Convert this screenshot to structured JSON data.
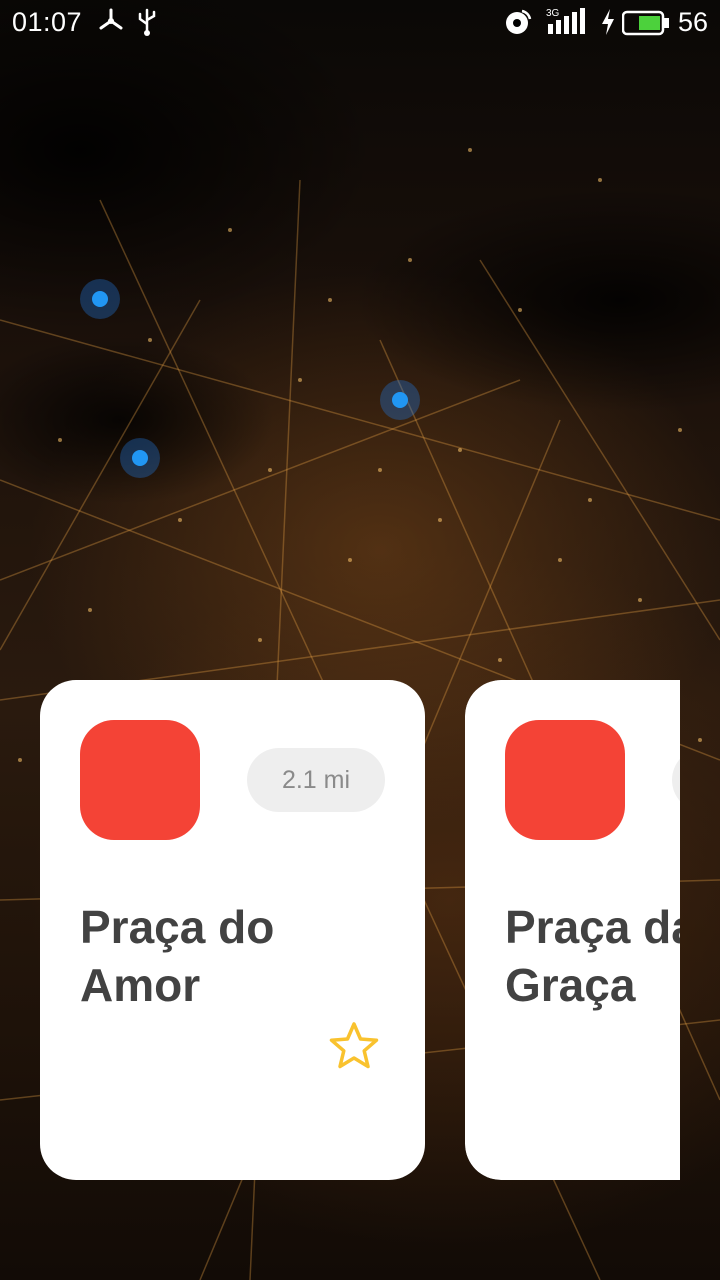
{
  "status_bar": {
    "time": "01:07",
    "battery_level": "56",
    "network": "3G",
    "icons": [
      "fan-icon",
      "usb-icon",
      "hotspot-icon",
      "signal-icon",
      "charging-icon",
      "battery-icon"
    ]
  },
  "map": {
    "markers": [
      {
        "name": "map-marker-1"
      },
      {
        "name": "map-marker-2"
      },
      {
        "name": "map-marker-3"
      }
    ]
  },
  "cards": [
    {
      "title": "Praça do\nAmor",
      "distance": "2.1 mi",
      "favorite_icon": "star-outline-icon",
      "logo_color": "#f44336"
    },
    {
      "title": "Praça da\nGraça",
      "distance": "",
      "logo_color": "#f44336"
    }
  ],
  "colors": {
    "accent_red": "#f44336",
    "marker_blue": "#2196f3",
    "star_yellow": "#f9c22e",
    "title_text": "#424242"
  }
}
